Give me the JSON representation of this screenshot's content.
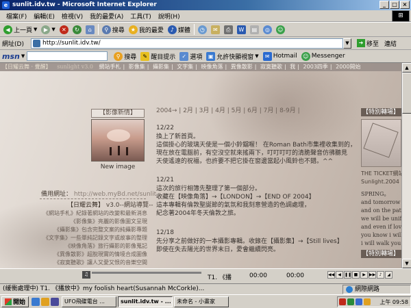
{
  "window": {
    "title": "sunlit.idv.tw - Microsoft Internet Explorer",
    "app_icon": "e",
    "btn_minimize": "_",
    "btn_maximize": "□",
    "btn_close": "×"
  },
  "menu": [
    "檔案(F)",
    "編輯(E)",
    "檢視(V)",
    "我的最愛(A)",
    "工具(T)",
    "說明(H)"
  ],
  "toolbar": {
    "back": "上一頁",
    "search": "搜尋",
    "favorites": "我的最愛",
    "media": "媒體"
  },
  "address": {
    "label": "網址(D)",
    "value": "http://sunlit.idv.tw/",
    "go": "移至",
    "links": "連結"
  },
  "msn": {
    "logo": "msn",
    "search": "搜尋",
    "highlight": "醒目提示",
    "options": "選項",
    "popup": "允許快顯視窗",
    "hotmail": "Hotmail",
    "messenger": "Messenger"
  },
  "site": {
    "nav": [
      "【日耀云舞 · 覺醒】",
      "sunlight v3.0",
      "網站手札",
      "影像集",
      "攝影集",
      "文字集",
      "映像角落",
      "異像散影",
      "寂寞聽歌",
      "我",
      "2003四季",
      "2000開始"
    ],
    "months": "2004→ | 2月 | 3月 | 4月 | 5月 | 6月 | 7月 | 8-9月 |",
    "new_box_title": "【影像新情】",
    "new_image": "New image",
    "backup_label": "備用網址：",
    "backup_url": "http://web.myBd.net/sunlit",
    "sun_title": "【日耀云舞】",
    "sun_version": "v3.0--網站導覽--",
    "left_lines": [
      "《網站手札》紀錄著網站的改變和最新消息",
      "《影像集》亮麗的影像圖文呈現",
      "《攝影集》包含完整文案的純攝影專題",
      "《文字集》一些單純記錄文字或故事的整理",
      "《映像角落》旅行攝影的影像蒐記",
      "《異像散影》超脫現實的情境合成圖像",
      "《寂寞聽歌》讓人又愛又恨的音樂空間"
    ],
    "entries": [
      {
        "date": "12/22",
        "lines": [
          "換上了新首頁。",
          "這個掛心的玻璃天使是一個小鈴鐺喔！ 在Roman Bath市集裡收集到的，",
          "現在放在電腦前，有空沒空就來搖兩下，叮叮叮叮的清脆聲音仿彿聽見",
          "天使遙遠的祝福，也許要不把它掛在窗邊當起小風鈴也不錯。^^"
        ]
      },
      {
        "date": "12/21",
        "lines": [
          "這次的旅行相簿先整理了第一個部分。",
          "收藏在【映像角落】→【LONDON】→【END OF 2004】",
          "這本專輯有倫敦聖誕節的氣氛和我刻意營造的色調處理，",
          "紀念著2004年冬天倫敦之旅。"
        ]
      },
      {
        "date": "12/18",
        "lines": [
          "先分享之前做好的一本攝影專輯。收錄在【攝影集】→【Still lives】",
          "",
          "即使在失去陽光的世界末日，愛會繼續閃亮。"
        ]
      }
    ],
    "right_title_1": "【特別轉場】",
    "right_caption_1": "THE TICKET網站",
    "right_caption_2": "Sunlight.2004",
    "right_poem": [
      "SPRING。",
      "and tomorrow the su",
      "and on the path we'l",
      "we will be unified a",
      "and even if love is s",
      "you know i will wal",
      "i will walk you all t"
    ],
    "right_title_2": "【特別轉場】"
  },
  "media": {
    "title": "T1. 《播",
    "time_now": "00:00",
    "time_total": "00:00"
  },
  "status": {
    "text": "(緩衝處理中) T1. 《播放中》my foolish heart(Susannah McCorkle)...",
    "zone": "網際網路"
  },
  "taskbar": {
    "start": "開始",
    "tasks": [
      "UFO飛碟電台 ...",
      "sunlit.idv.tw - ...",
      "未命名 - 小畫家"
    ],
    "clock": "上午 09:58"
  },
  "colors": {
    "title_gradient_start": "#0a246a",
    "accent_brown": "#6a5e56",
    "page_bg": "#d6ccc4"
  }
}
